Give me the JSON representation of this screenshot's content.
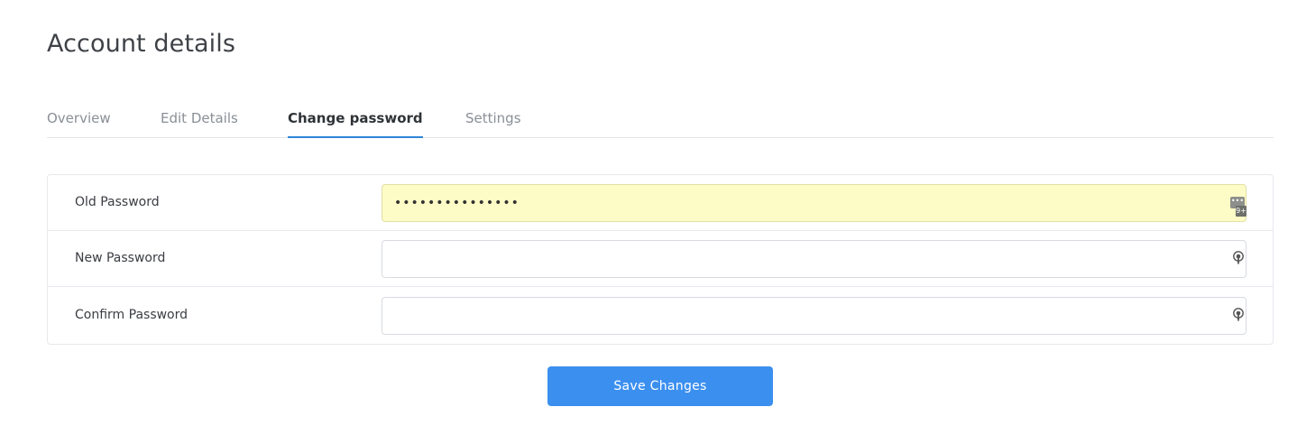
{
  "header": {
    "title": "Account details"
  },
  "tabs": [
    {
      "label": "Overview",
      "active": false
    },
    {
      "label": "Edit Details",
      "active": false
    },
    {
      "label": "Change password",
      "active": true
    },
    {
      "label": "Settings",
      "active": false
    }
  ],
  "form": {
    "old_password": {
      "label": "Old Password",
      "value": "•••••••••••••••",
      "autofilled": true,
      "manager_badge": {
        "dots": "•••",
        "count": "9+"
      }
    },
    "new_password": {
      "label": "New Password",
      "value": "",
      "placeholder": ""
    },
    "confirm_password": {
      "label": "Confirm Password",
      "value": "",
      "placeholder": ""
    }
  },
  "actions": {
    "save_label": "Save Changes"
  },
  "colors": {
    "accent": "#3b8fef",
    "tab_underline": "#2f86d8",
    "autofill_bg": "#fefcc6"
  }
}
